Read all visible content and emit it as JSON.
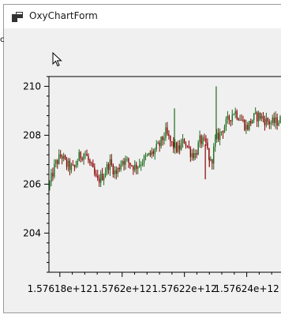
{
  "window": {
    "title": "OxyChartForm",
    "side_glyph": "c"
  },
  "colors": {
    "candle_up": "#1f6b1f",
    "candle_down": "#8b0000",
    "axis": "#000000",
    "background": "#f0f0f0"
  },
  "icons": {
    "app": "app-form-icon",
    "cursor": "mouse-cursor-icon"
  },
  "chart_data": {
    "type": "candlestick",
    "title": "",
    "xlabel": "",
    "ylabel": "",
    "x_tick_labels": [
      "1.57618e+12",
      "1.5762e+12",
      "1.57622e+12",
      "1.57624e+12"
    ],
    "x_ticks": [
      1576180000000,
      1576200000000,
      1576220000000,
      1576240000000
    ],
    "y_tick_labels": [
      "204",
      "206",
      "208",
      "210"
    ],
    "y_ticks": [
      204,
      206,
      208,
      210
    ],
    "xlim": [
      1576176500000,
      1576251000000
    ],
    "ylim": [
      202.4,
      210.4
    ],
    "grid": false,
    "legend": "none",
    "trend": {
      "x": [
        1576176500000,
        1576178500000,
        1576180500000,
        1576182000000,
        1576184500000,
        1576186000000,
        1576188000000,
        1576190000000,
        1576192000000,
        1576194000000,
        1576196000000,
        1576198000000,
        1576200000000,
        1576202000000,
        1576204000000,
        1576206000000,
        1576208000000,
        1576210000000,
        1576212000000,
        1576214000000,
        1576216000000,
        1576218000000,
        1576220000000,
        1576222000000,
        1576223500000,
        1576225000000,
        1576227000000,
        1576228500000,
        1576230000000,
        1576232000000,
        1576234000000,
        1576236000000,
        1576238000000,
        1576240000000,
        1576242000000,
        1576244000000,
        1576246000000,
        1576248000000,
        1576250500000
      ],
      "y": [
        205.9,
        206.8,
        207.2,
        206.8,
        206.6,
        207.1,
        207.3,
        206.7,
        206.1,
        206.4,
        206.9,
        206.4,
        207.0,
        206.9,
        206.7,
        206.9,
        207.1,
        207.3,
        207.6,
        208.1,
        207.6,
        207.4,
        207.8,
        207.3,
        207.2,
        207.8,
        207.6,
        206.8,
        207.8,
        208.2,
        208.6,
        209.0,
        208.7,
        208.3,
        208.7,
        208.8,
        208.6,
        208.5,
        208.6
      ]
    },
    "spikes": [
      {
        "x": 1576216800000,
        "y": 209.1
      },
      {
        "x": 1576226700000,
        "y": 206.2
      },
      {
        "x": 1576230200000,
        "y": 210.0
      },
      {
        "x": 1576228000000,
        "y": 206.7
      }
    ]
  }
}
